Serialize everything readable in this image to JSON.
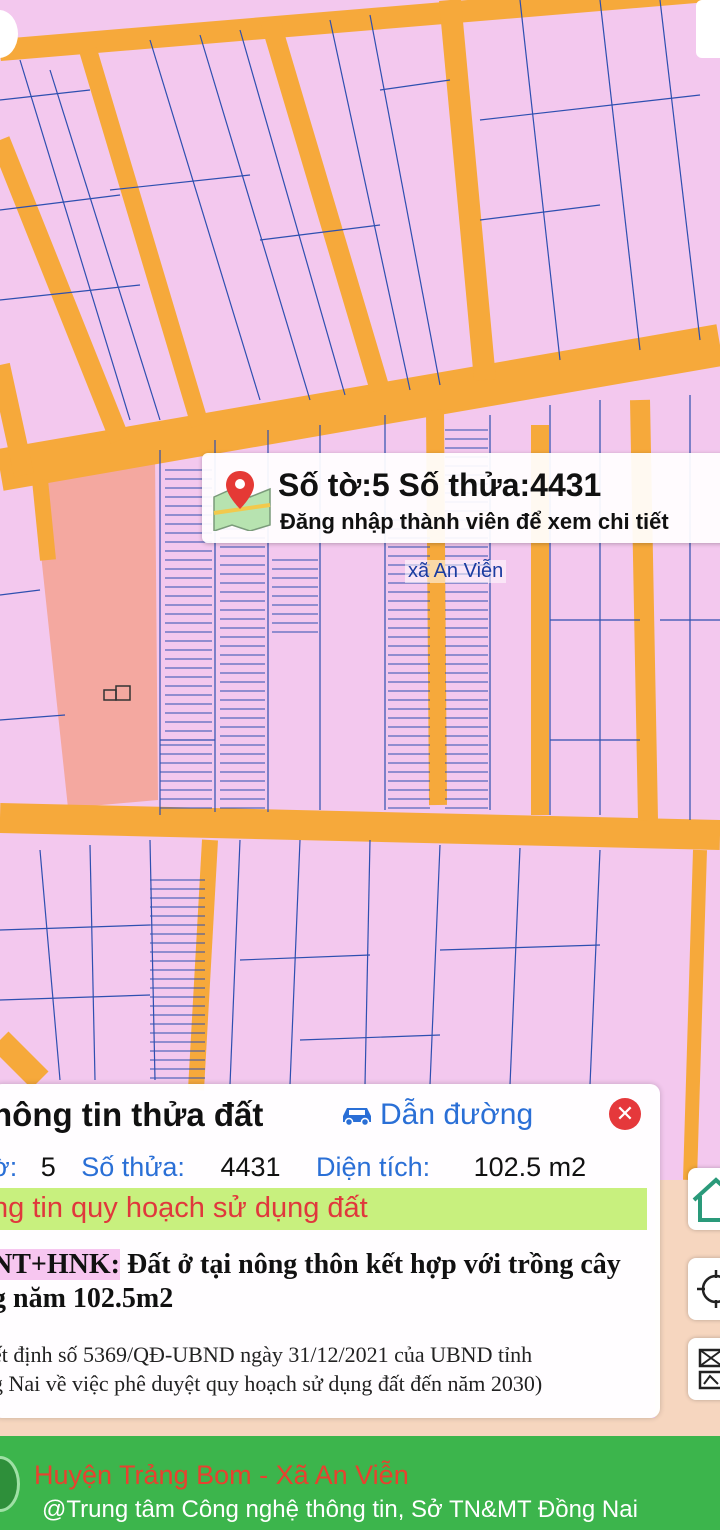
{
  "popup": {
    "title": "Số tờ:5 Số thửa:4431",
    "subtitle": "Đăng nhập thành viên để xem chi tiết",
    "icon": "map-pin-icon"
  },
  "map": {
    "commune_label": "xã An Viễn",
    "colors": {
      "land": "#f3c8ee",
      "road": "#f6a93b",
      "special_parcel": "#f4a8a0",
      "parcel_line": "#2e4fb0"
    }
  },
  "panel": {
    "title": "hông tin thửa đất",
    "nav_label": "Dẫn đường",
    "nav_icon": "car-icon",
    "close_icon": "close-icon",
    "sheet_label": "ờ:",
    "sheet_value": "5",
    "parcel_label": "Số thửa:",
    "parcel_value": "4431",
    "area_label": "Diện tích:",
    "area_value": "102.5 m2",
    "section_title": "ng tin quy hoạch sử dụng đất",
    "land_code": "NT+HNK:",
    "land_desc_line1": "Đất ở tại nông thôn kết hợp với trồng cây",
    "land_desc_line2": "g năm 102.5m2",
    "decision_line1": "ết định số 5369/QĐ-UBND ngày 31/12/2021 của UBND tỉnh",
    "decision_line2": "g Nai về việc phê duyệt quy hoạch sử dụng đất đến năm 2030)"
  },
  "side_buttons": [
    "home-icon",
    "locate-icon",
    "map-layers-icon"
  ],
  "footer": {
    "line1": "Huyện Trảng Bom - Xã An Viễn",
    "line2": "@Trung tâm Công nghệ thông tin, Sở TN&MT Đồng Nai"
  }
}
